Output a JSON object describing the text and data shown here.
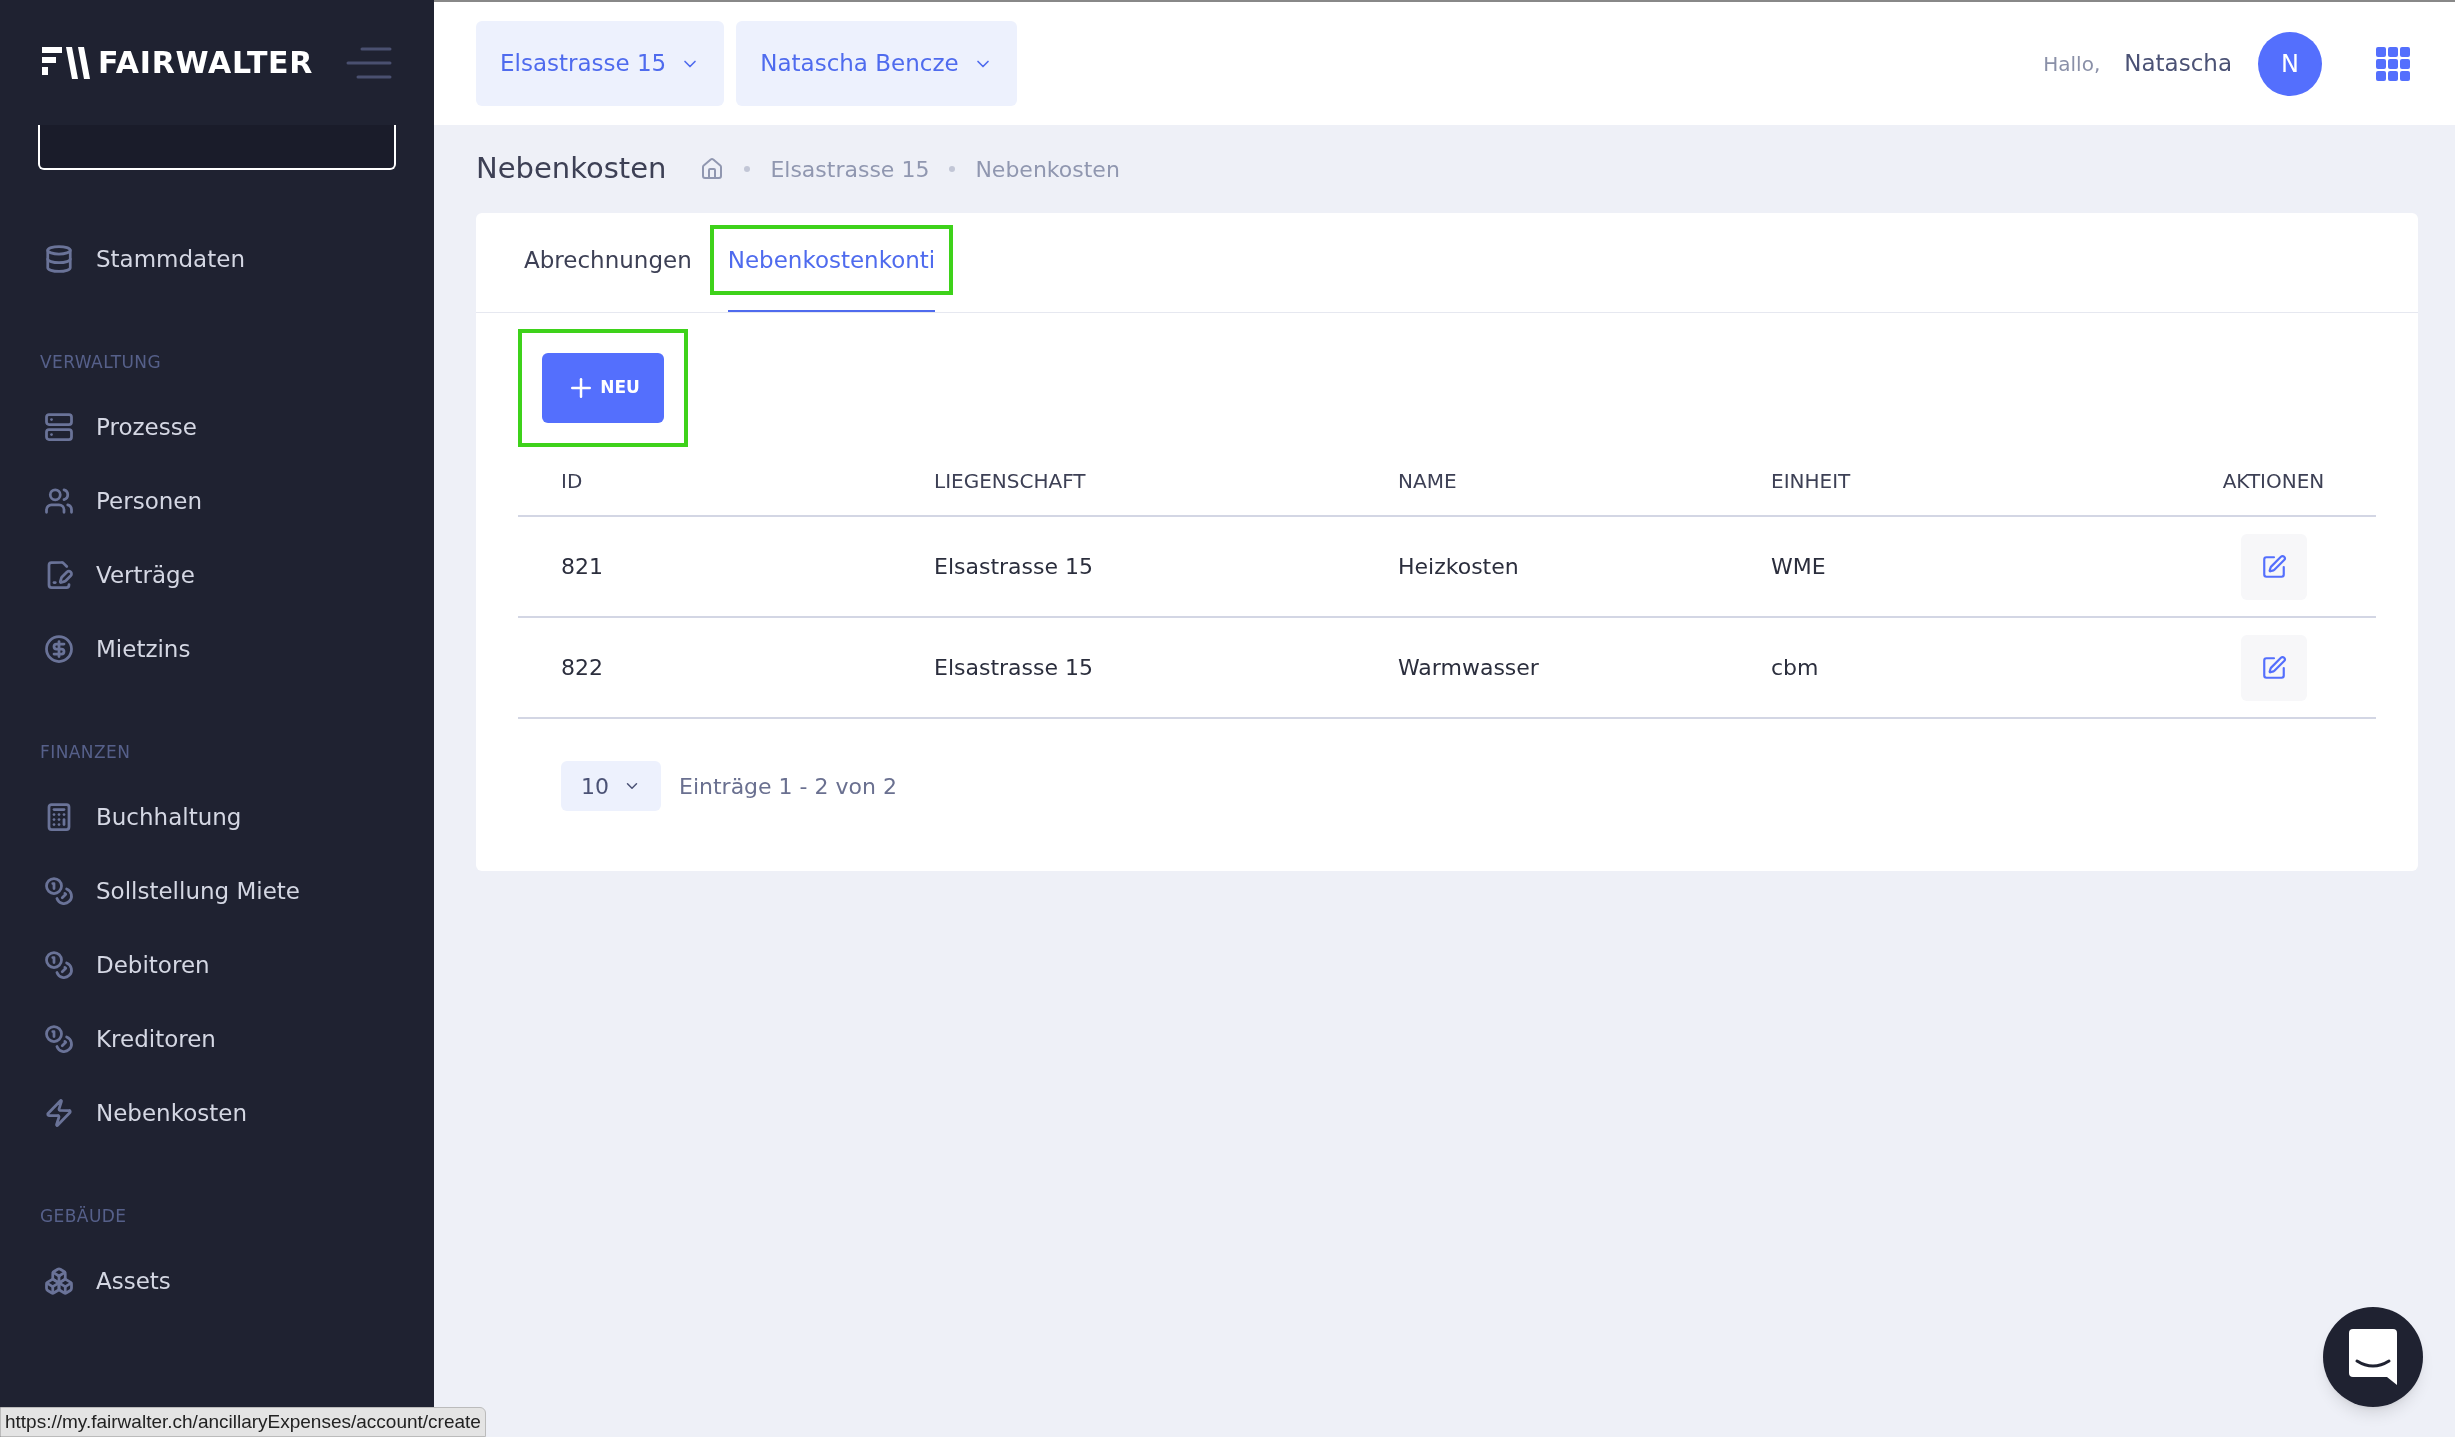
{
  "sidebar": {
    "logo": "FAIRWALTER",
    "sections": [
      {
        "items": [
          {
            "label": "Stammdaten"
          }
        ]
      },
      {
        "heading": "VERWALTUNG",
        "items": [
          {
            "label": "Prozesse"
          },
          {
            "label": "Personen"
          },
          {
            "label": "Verträge"
          },
          {
            "label": "Mietzins"
          }
        ]
      },
      {
        "heading": "FINANZEN",
        "items": [
          {
            "label": "Buchhaltung"
          },
          {
            "label": "Sollstellung Miete"
          },
          {
            "label": "Debitoren"
          },
          {
            "label": "Kreditoren"
          },
          {
            "label": "Nebenkosten"
          }
        ]
      },
      {
        "heading": "GEBÄUDE",
        "items": [
          {
            "label": "Assets"
          }
        ]
      }
    ]
  },
  "header": {
    "selectors": [
      "Elsastrasse 15",
      "Natascha Bencze"
    ],
    "greeting": "Hallo,",
    "user_name": "Natascha",
    "avatar_initial": "N"
  },
  "page": {
    "title": "Nebenkosten",
    "breadcrumb": [
      "Elsastrasse 15",
      "Nebenkosten"
    ]
  },
  "tabs": [
    {
      "label": "Abrechnungen",
      "selected": false,
      "highlighted": false
    },
    {
      "label": "Nebenkostenkonti",
      "selected": true,
      "highlighted": true
    }
  ],
  "new_button": {
    "label": "NEU",
    "highlighted": true
  },
  "table": {
    "columns": [
      "ID",
      "LIEGENSCHAFT",
      "NAME",
      "EINHEIT",
      "AKTIONEN"
    ],
    "rows": [
      [
        "821",
        "Elsastrasse 15",
        "Heizkosten",
        "WME"
      ],
      [
        "822",
        "Elsastrasse 15",
        "Warmwasser",
        "cbm"
      ]
    ]
  },
  "pagination": {
    "page_size": "10",
    "summary": "Einträge 1 - 2 von 2"
  },
  "status_url": "https://my.fairwalter.ch/ancillaryExpenses/account/create"
}
